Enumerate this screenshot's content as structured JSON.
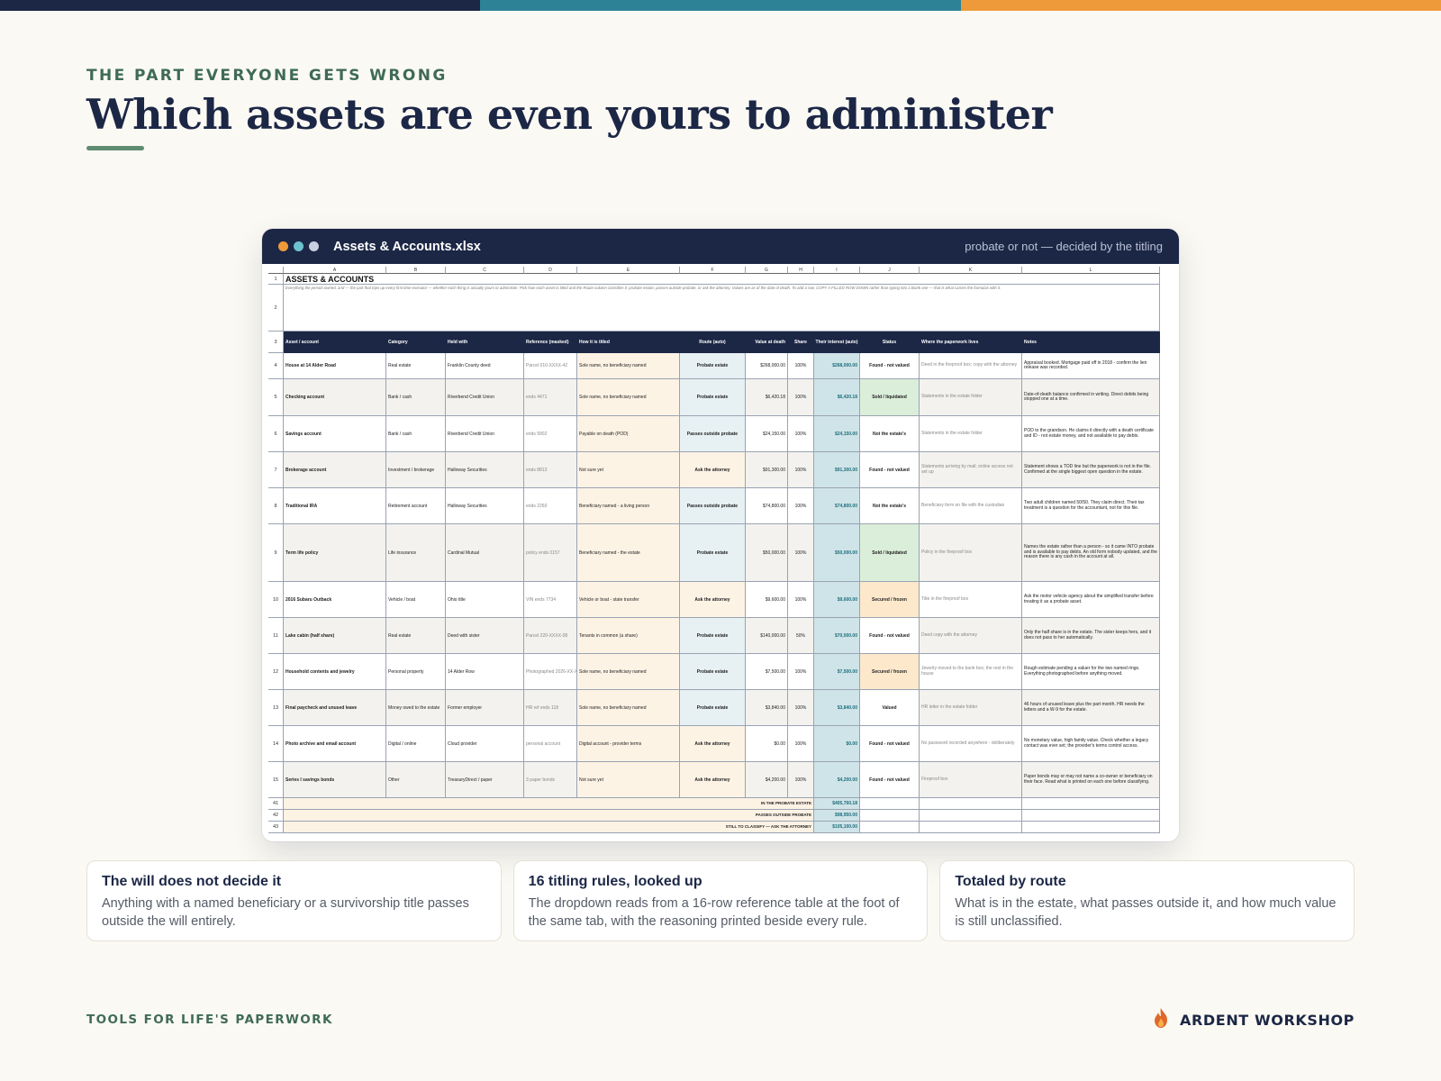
{
  "colors": {
    "navy": "#1c2746",
    "teal": "#2e8296",
    "orange": "#ee9a3a",
    "green_text": "#3f6b55",
    "route_fill": "#e7f0f3",
    "howtitled_fill": "#fdf3e5",
    "interest_fill": "#cfe4e8",
    "status_green": "#dbeed9",
    "status_orange": "#fde8cc"
  },
  "header": {
    "eyebrow": "THE PART EVERYONE GETS WRONG",
    "title": "Which assets are even yours to administer"
  },
  "window": {
    "filename": "Assets & Accounts.xlsx",
    "subtitle": "probate or not — decided by the titling",
    "dot_colors": [
      "#ee9a3a",
      "#6cc3cf",
      "#c9cfe0"
    ]
  },
  "sheet": {
    "columns": [
      "A",
      "B",
      "C",
      "D",
      "E",
      "F",
      "G",
      "H",
      "I",
      "J",
      "K",
      "L"
    ],
    "title": "ASSETS & ACCOUNTS",
    "description": "Everything the person owned, and — the part that trips up every first-time executor — whether each thing is actually yours to administer. Pick how each asset is titled and the Route column classifies it: probate estate, passes outside probate, or ask the attorney. Values are as of the date of death. To add a row, COPY A FILLED ROW DOWN rather than typing into a blank one — that is what carries the formulas with it.",
    "headers": [
      "Asset / account",
      "Category",
      "Held with",
      "Reference (masked)",
      "How it is titled",
      "Route (auto)",
      "Value at death",
      "Share",
      "Their interest (auto)",
      "Status",
      "Where the paperwork lives",
      "Notes"
    ],
    "rows": [
      {
        "n": "4",
        "asset": "House at 14 Alder Road",
        "category": "Real estate",
        "held": "Franklin County deed",
        "ref": "Parcel 010-XXXX-42",
        "titled": "Sole name, no beneficiary named",
        "route": "Probate estate",
        "value": "$268,000.00",
        "share": "100%",
        "interest": "$268,000.00",
        "status": "Found - not valued",
        "status_kind": "plain",
        "where": "Deed in the fireproof box; copy with the attorney",
        "notes": "Appraisal booked. Mortgage paid off in 2018 - confirm the lien release was recorded."
      },
      {
        "n": "5",
        "asset": "Checking account",
        "category": "Bank / cash",
        "held": "Riverbend Credit Union",
        "ref": "ends 4471",
        "titled": "Sole name, no beneficiary named",
        "route": "Probate estate",
        "value": "$6,420.18",
        "share": "100%",
        "interest": "$6,420.18",
        "status": "Sold / liquidated",
        "status_kind": "green",
        "where": "Statements in the estate folder",
        "notes": "Date-of-death balance confirmed in writing. Direct debits being stopped one at a time."
      },
      {
        "n": "6",
        "asset": "Savings account",
        "category": "Bank / cash",
        "held": "Riverbend Credit Union",
        "ref": "ends 9902",
        "titled": "Payable on death (POD)",
        "route": "Passes outside probate",
        "value": "$24,150.00",
        "share": "100%",
        "interest": "$24,150.00",
        "status": "Not the estate's",
        "status_kind": "plain",
        "where": "Statements in the estate folder",
        "notes": "POD to the grandson. He claims it directly with a death certificate and ID - not estate money, and not available to pay debts."
      },
      {
        "n": "7",
        "asset": "Brokerage account",
        "category": "Investment / brokerage",
        "held": "Halloway Securities",
        "ref": "ends 8813",
        "titled": "Not sure yet",
        "route": "Ask the attorney",
        "value": "$91,300.00",
        "share": "100%",
        "interest": "$91,300.00",
        "status": "Found - not valued",
        "status_kind": "plain",
        "where": "Statements arriving by mail; online access not set up",
        "notes": "Statement shows a TOD line but the paperwork is not in the file. Confirmed at the single biggest open question in the estate."
      },
      {
        "n": "8",
        "asset": "Traditional IRA",
        "category": "Retirement account",
        "held": "Halloway Securities",
        "ref": "ends 2260",
        "titled": "Beneficiary named - a living person",
        "route": "Passes outside probate",
        "value": "$74,800.00",
        "share": "100%",
        "interest": "$74,800.00",
        "status": "Not the estate's",
        "status_kind": "plain",
        "where": "Beneficiary form on file with the custodian",
        "notes": "Two adult children named 50/50. They claim direct. Their tax treatment is a question for the accountant, not for this file."
      },
      {
        "n": "9",
        "asset": "Term life policy",
        "category": "Life insurance",
        "held": "Cardinal Mutual",
        "ref": "policy ends 0157",
        "titled": "Beneficiary named - the estate",
        "route": "Probate estate",
        "value": "$50,000.00",
        "share": "100%",
        "interest": "$50,000.00",
        "status": "Sold / liquidated",
        "status_kind": "green",
        "where": "Policy in the fireproof box",
        "notes": "Names the estate rather than a person - so it came INTO probate and is available to pay debts. An old form nobody updated, and the reason there is any cash in the account at all."
      },
      {
        "n": "10",
        "asset": "2016 Subaru Outback",
        "category": "Vehicle / boat",
        "held": "Ohio title",
        "ref": "VIN ends 7734",
        "titled": "Vehicle or boat - state transfer",
        "route": "Ask the attorney",
        "value": "$9,600.00",
        "share": "100%",
        "interest": "$9,600.00",
        "status": "Secured / frozen",
        "status_kind": "orange",
        "where": "Title in the fireproof box",
        "notes": "Ask the motor vehicle agency about the simplified transfer before treating it as a probate asset."
      },
      {
        "n": "11",
        "asset": "Lake cabin (half share)",
        "category": "Real estate",
        "held": "Deed with sister",
        "ref": "Parcel 220-XXXX-08",
        "titled": "Tenants in common (a share)",
        "route": "Probate estate",
        "value": "$140,000.00",
        "share": "50%",
        "interest": "$70,000.00",
        "status": "Found - not valued",
        "status_kind": "plain",
        "where": "Deed copy with the attorney",
        "notes": "Only the half share is in the estate. The sister keeps hers, and it does not pass to her automatically."
      },
      {
        "n": "12",
        "asset": "Household contents and jewelry",
        "category": "Personal property",
        "held": "14 Alder Row",
        "ref": "Photographed 2026-XX-XX",
        "titled": "Sole name, no beneficiary named",
        "route": "Probate estate",
        "value": "$7,500.00",
        "share": "100%",
        "interest": "$7,500.00",
        "status": "Secured / frozen",
        "status_kind": "orange",
        "where": "Jewelry moved to the bank box; the rest in the house",
        "notes": "Rough estimate pending a valuer for the two named rings. Everything photographed before anything moved."
      },
      {
        "n": "13",
        "asset": "Final paycheck and unused leave",
        "category": "Money owed to the estate",
        "held": "Former employer",
        "ref": "HR ref ends 118",
        "titled": "Sole name, no beneficiary named",
        "route": "Probate estate",
        "value": "$3,840.00",
        "share": "100%",
        "interest": "$3,840.00",
        "status": "Valued",
        "status_kind": "plain",
        "where": "HR letter in the estate folder",
        "notes": "46 hours of unused leave plus the part month. HR needs the letters and a W-9 for the estate."
      },
      {
        "n": "14",
        "asset": "Photo archive and email account",
        "category": "Digital / online",
        "held": "Cloud provider",
        "ref": "personal account",
        "titled": "Digital account - provider terms",
        "route": "Ask the attorney",
        "value": "$0.00",
        "share": "100%",
        "interest": "$0.00",
        "status": "Found - not valued",
        "status_kind": "plain",
        "where": "No password recorded anywhere - deliberately",
        "notes": "No monetary value, high family value. Check whether a legacy contact was ever set; the provider's terms control access."
      },
      {
        "n": "15",
        "asset": "Series I savings bonds",
        "category": "Other",
        "held": "TreasuryDirect / paper",
        "ref": "3 paper bonds",
        "titled": "Not sure yet",
        "route": "Ask the attorney",
        "value": "$4,200.00",
        "share": "100%",
        "interest": "$4,200.00",
        "status": "Found - not valued",
        "status_kind": "plain",
        "where": "Fireproof box",
        "notes": "Paper bonds may or may not name a co-owner or beneficiary on their face. Read what is printed on each one before classifying."
      }
    ],
    "totals": [
      {
        "n": "41",
        "label": "IN THE PROBATE ESTATE",
        "value": "$405,760.18"
      },
      {
        "n": "42",
        "label": "PASSES OUTSIDE PROBATE",
        "value": "$98,950.00"
      },
      {
        "n": "43",
        "label": "STILL TO CLASSIFY — ASK THE ATTORNEY",
        "value": "$105,100.00"
      }
    ]
  },
  "cards": [
    {
      "title": "The will does not decide it",
      "body": "Anything with a named beneficiary or a survivorship title passes outside the will entirely."
    },
    {
      "title": "16 titling rules, looked up",
      "body": "The dropdown reads from a 16-row reference table at the foot of the same tab, with the reasoning printed beside every rule."
    },
    {
      "title": "Totaled by route",
      "body": "What is in the estate, what passes outside it, and how much value is still unclassified."
    }
  ],
  "footer": {
    "left": "TOOLS FOR LIFE'S PAPERWORK",
    "brand": "ARDENT WORKSHOP",
    "logo_icon": "flame-icon"
  }
}
